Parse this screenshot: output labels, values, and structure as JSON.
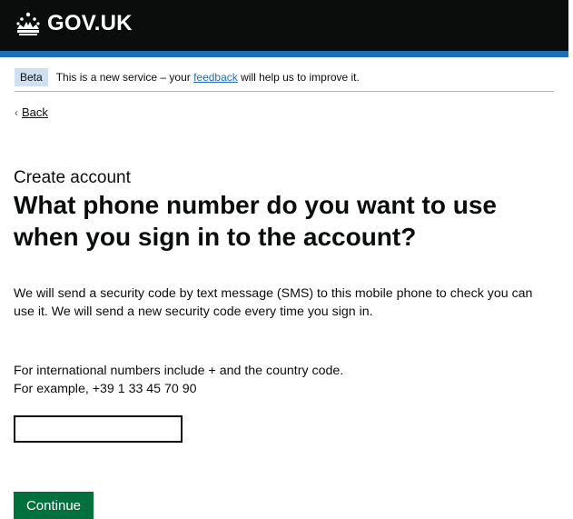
{
  "header": {
    "logo_text": "GOV.UK",
    "logo_icon": "crown-icon"
  },
  "phase_banner": {
    "tag": "Beta",
    "text_before": "This is a new service – your ",
    "link_text": "feedback",
    "text_after": " will help us to improve it."
  },
  "back_link": {
    "chevron": "‹",
    "label": "Back"
  },
  "page": {
    "caption": "Create account",
    "heading": "What phone number do you want to use when you sign in to the account?",
    "body": "We will send a security code by text message (SMS) to this mobile phone to check you can use it. We will send a new security code every time you sign in.",
    "hint_line1": "For international numbers include + and the country code.",
    "hint_line2": "For example, +39 1 33 45 70 90"
  },
  "form": {
    "phone_value": "",
    "continue_label": "Continue"
  },
  "colors": {
    "header_bg": "#0b0c0c",
    "header_stripe": "#1d70b8",
    "link": "#1d70b8",
    "button": "#00703c",
    "phase_tag_bg": "#cfe1f0"
  }
}
